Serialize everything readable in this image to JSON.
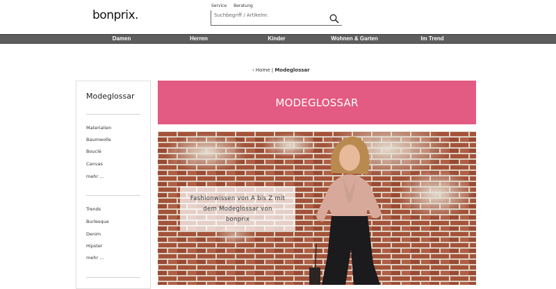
{
  "header": {
    "logo": "bonprix.",
    "service_links": [
      "Service",
      "Beratung"
    ],
    "search": {
      "placeholder": "Suchbegriff / Artikelnr.",
      "icon": "search-icon"
    }
  },
  "nav": {
    "items": [
      "Damen",
      "Herren",
      "Kinder",
      "Wohnen & Garten",
      "Im Trend"
    ]
  },
  "breadcrumb": {
    "home": "Home",
    "separator": "|",
    "current": "Modeglossar"
  },
  "sidebar": {
    "title": "Modeglossar",
    "group1": [
      "Materialien",
      "Baumwolle",
      "Bouclé",
      "Canvas",
      "mehr ..."
    ],
    "group2": [
      "Trends",
      "Burlesque",
      "Denim",
      "Hipster",
      "mehr ..."
    ]
  },
  "main": {
    "title": "MODEGLOSSAR",
    "hero_text": [
      "Fashionwissen von A bis Z mit",
      "dem Modeglossar von",
      "bonprix"
    ]
  },
  "colors": {
    "accent_pink": "#e35a82",
    "nav_bg": "#5d5d5d",
    "brick": "#a5553d"
  }
}
